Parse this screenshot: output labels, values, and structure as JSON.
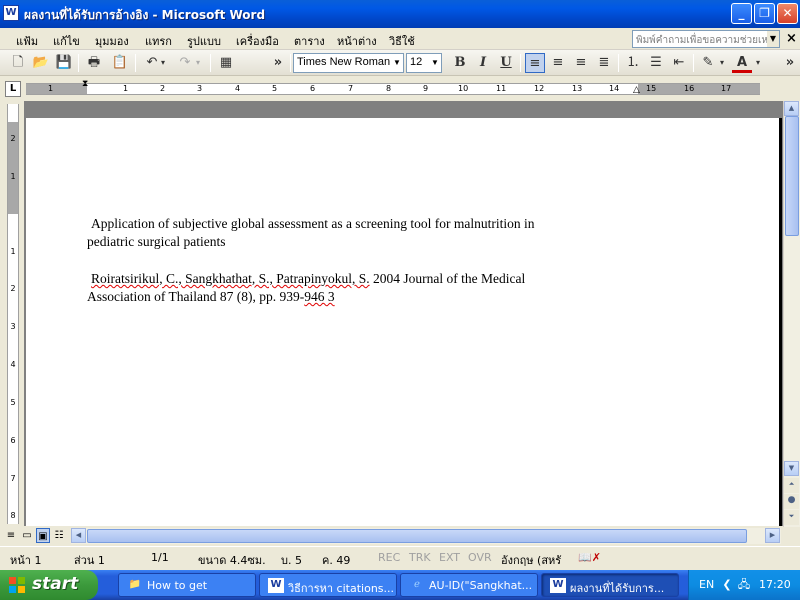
{
  "window": {
    "title": "ผลงานที่ได้รับการอ้างอิง - Microsoft Word",
    "app_icon": "W",
    "minimize": "_",
    "maximize": "❐",
    "close": "✕"
  },
  "menu": {
    "items": [
      "แฟ้ม",
      "แก้ไข",
      "มุมมอง",
      "แทรก",
      "รูปแบบ",
      "เครื่องมือ",
      "ตาราง",
      "หน้าต่าง",
      "วิธีใช้"
    ],
    "help_placeholder": "พิมพ์คำถามเพื่อขอความช่วยเหลือ",
    "doc_close": "×"
  },
  "toolbar": {
    "font_name": "Times New Roman",
    "font_size": "12",
    "bold": "B",
    "italic": "I",
    "underline": "U",
    "overflow": "»",
    "icons": [
      "new-document-icon",
      "open-folder-icon",
      "save-icon",
      "print-icon",
      "paste-icon",
      "undo-icon",
      "redo-icon",
      "table-icon",
      "align-left-icon",
      "align-center-icon",
      "align-right-icon",
      "justify-icon",
      "numbering-icon",
      "bullets-icon",
      "outdent-icon",
      "highlight-icon",
      "font-color-icon"
    ]
  },
  "ruler": {
    "tab_selector": "L",
    "h_labels": [
      "1",
      "1",
      "2",
      "3",
      "4",
      "5",
      "6",
      "7",
      "8",
      "9",
      "10",
      "11",
      "12",
      "13",
      "14",
      "15",
      "16",
      "17"
    ],
    "v_labels": [
      "2",
      "1",
      "1",
      "2",
      "3",
      "4",
      "5",
      "6",
      "7",
      "8"
    ]
  },
  "document": {
    "title_line1": "Application of subjective global assessment as a screening tool for malnutrition in",
    "title_line2": "pediatric surgical patients",
    "authors_line1_names": "Roiratsirikul, C., Sangkhathat, S., Patrapinyokul, S.",
    "authors_line1_rest": "2004 Journal of the Medical",
    "authors_line2_start": "Association of Thailand 87 (8), pp. 939-",
    "authors_line2_sq": "946  3"
  },
  "statusbar": {
    "page": "หน้า 1",
    "section": "ส่วน 1",
    "page_of": "1/1",
    "position": "ขนาด 4.4ซม.",
    "line": "บ. 5",
    "column": "ค. 49",
    "rec": "REC",
    "trk": "TRK",
    "ext": "EXT",
    "ovr": "OVR",
    "language": "อังกฤษ (สหรั"
  },
  "taskbar": {
    "start_label": "start",
    "tasks": [
      {
        "label": "How to get",
        "icon": "folder-icon"
      },
      {
        "label": "วิธีการหา citations...",
        "icon": "word-document-icon"
      },
      {
        "label": "AU-ID(\"Sangkhat...",
        "icon": "browser-icon"
      },
      {
        "label": "ผลงานที่ได้รับการ...",
        "icon": "word-document-icon"
      }
    ],
    "language": "EN",
    "clock": "17:20"
  }
}
